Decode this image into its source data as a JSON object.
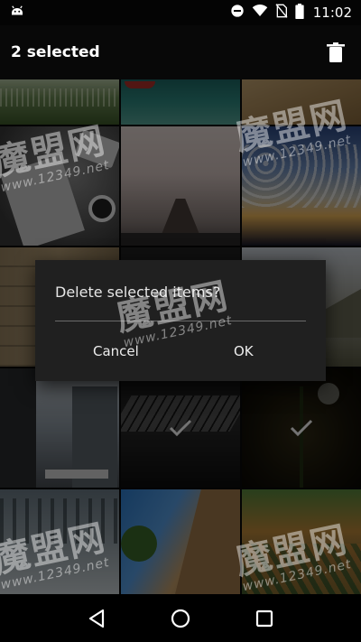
{
  "status_bar": {
    "time": "11:02",
    "icons": [
      "android-debug-icon",
      "do-not-disturb-icon",
      "wifi-icon",
      "no-sim-icon",
      "battery-icon"
    ]
  },
  "action_bar": {
    "title": "2 selected",
    "delete_icon": "trash-icon"
  },
  "gallery": {
    "tiles": [
      {
        "name": "photo-grass-field",
        "selected": false
      },
      {
        "name": "photo-lake-boat",
        "selected": false
      },
      {
        "name": "photo-sand-beach",
        "selected": false
      },
      {
        "name": "photo-newspaper-desk",
        "selected": false
      },
      {
        "name": "photo-foggy-pier",
        "selected": false
      },
      {
        "name": "photo-sunset-clouds",
        "selected": false
      },
      {
        "name": "photo-stone-wall",
        "selected": false
      },
      {
        "name": "photo-mountain-road",
        "selected": false
      },
      {
        "name": "photo-city-street",
        "selected": false
      },
      {
        "name": "photo-piano-hands",
        "selected": true
      },
      {
        "name": "photo-flower",
        "selected": true
      },
      {
        "name": "photo-snowy-forest",
        "selected": false
      },
      {
        "name": "photo-cliff-climber",
        "selected": false
      },
      {
        "name": "photo-autumn-valley",
        "selected": false
      }
    ]
  },
  "dialog": {
    "message": "Delete selected items?",
    "cancel_label": "Cancel",
    "ok_label": "OK"
  },
  "nav_bar": {
    "icons": [
      "back-icon",
      "home-icon",
      "recents-icon"
    ]
  },
  "watermark": {
    "text": "魔盟网",
    "url": "www.12349.net"
  },
  "colors": {
    "action_bar_bg": "#080808",
    "dialog_bg": "#202020",
    "divider": "#6a6a6a"
  }
}
